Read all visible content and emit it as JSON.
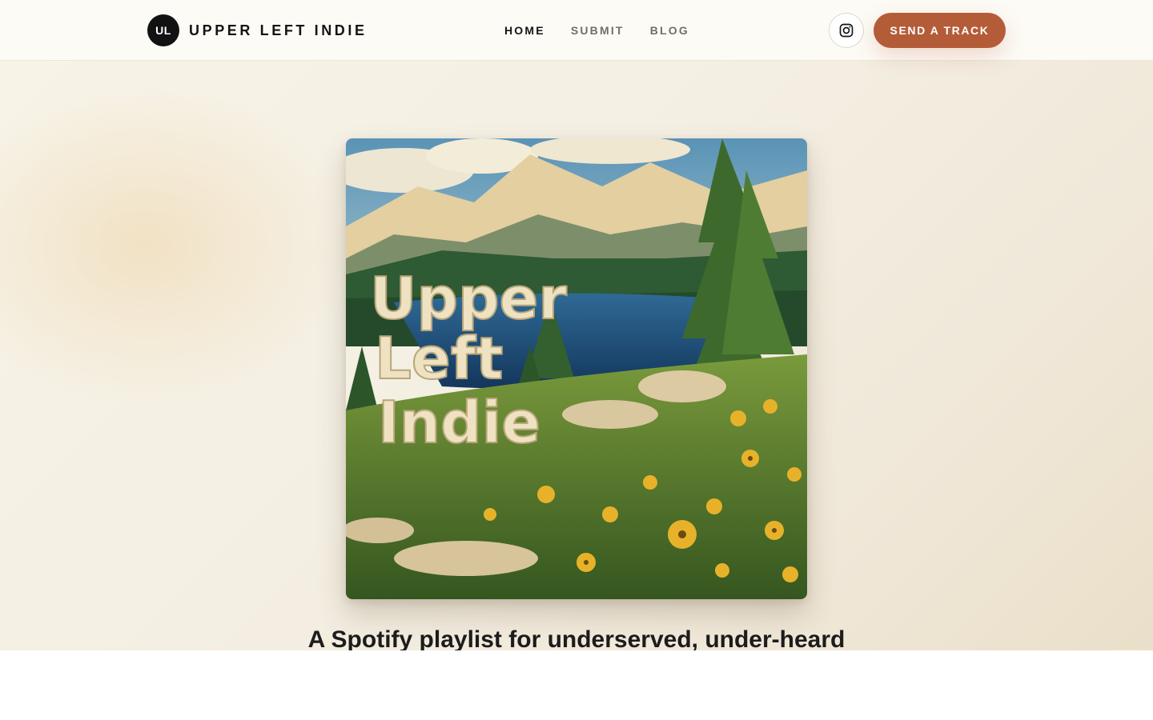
{
  "brand": {
    "badge": "UL",
    "name": "UPPER LEFT INDIE"
  },
  "nav": {
    "items": [
      {
        "label": "HOME",
        "active": true
      },
      {
        "label": "SUBMIT",
        "active": false
      },
      {
        "label": "BLOG",
        "active": false
      }
    ]
  },
  "header_actions": {
    "instagram_icon": "instagram-icon",
    "cta_label": "SEND A TRACK"
  },
  "hero": {
    "cover_title_lines": [
      "Upper",
      "Left",
      "Indie"
    ],
    "headline": "A Spotify playlist for underserved, under-heard"
  },
  "colors": {
    "accent": "#b45c38",
    "ink": "#141414",
    "muted_nav": "#707068",
    "header_bg": "#fdfbf6",
    "hero_bg": "#f4efe3"
  }
}
